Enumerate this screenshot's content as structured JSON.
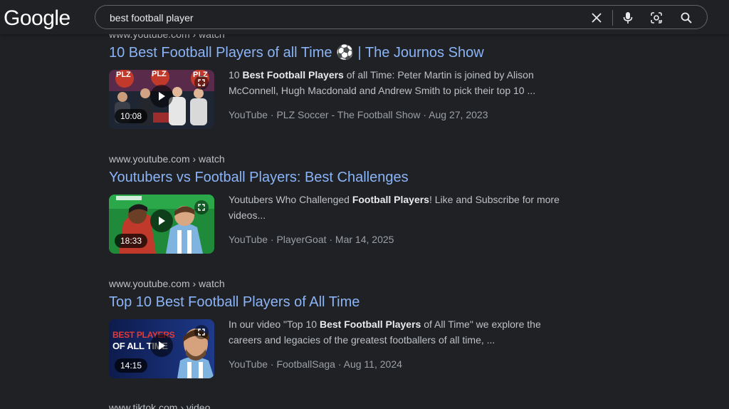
{
  "header": {
    "logo": "Google",
    "query": "best football player",
    "icons": [
      "clear-icon",
      "mic-icon",
      "lens-icon",
      "search-icon"
    ]
  },
  "top_partial_cite": "www.youtube.com › watch",
  "results": [
    {
      "cite": "www.youtube.com › watch",
      "title": "10 Best Football Players of all Time ⚽ | The Journos Show",
      "snippet_parts": [
        "10 ",
        "Best Football Players",
        " of all Time: Peter Martin is joined by Alison McConnell, Hugh Macdonald and Andrew Smith to pick their top 10 ..."
      ],
      "duration": "10:08",
      "thumb_logo": "PLZ",
      "meta": "YouTube · PLZ Soccer - The Football Show · Aug 27, 2023"
    },
    {
      "cite": "www.youtube.com › watch",
      "title": "Youtubers vs Football Players: Best Challenges",
      "snippet_parts": [
        "Youtubers Who Challenged ",
        "Football Players",
        "! Like and Subscribe for more videos..."
      ],
      "duration": "18:33",
      "meta": "YouTube · PlayerGoat · Mar 14, 2025"
    },
    {
      "cite": "www.youtube.com › watch",
      "title": "Top 10 Best Football Players of All Time",
      "snippet_parts": [
        "In our video \"Top 10 ",
        "Best Football Players",
        " of All Time\" we explore the careers and legacies of the greatest footballers of all time, ..."
      ],
      "duration": "14:15",
      "thumb_line1": "BEST PLAYERS",
      "thumb_line2": "OF ALL TIME",
      "meta": "YouTube · FootballSaga · Aug 11, 2024"
    }
  ],
  "bottom_partial_cite": "www.tiktok.com › video",
  "colors": {
    "background": "#202124",
    "link": "#8ab4f8",
    "text": "#bdc1c6",
    "muted": "#9aa0a6"
  }
}
